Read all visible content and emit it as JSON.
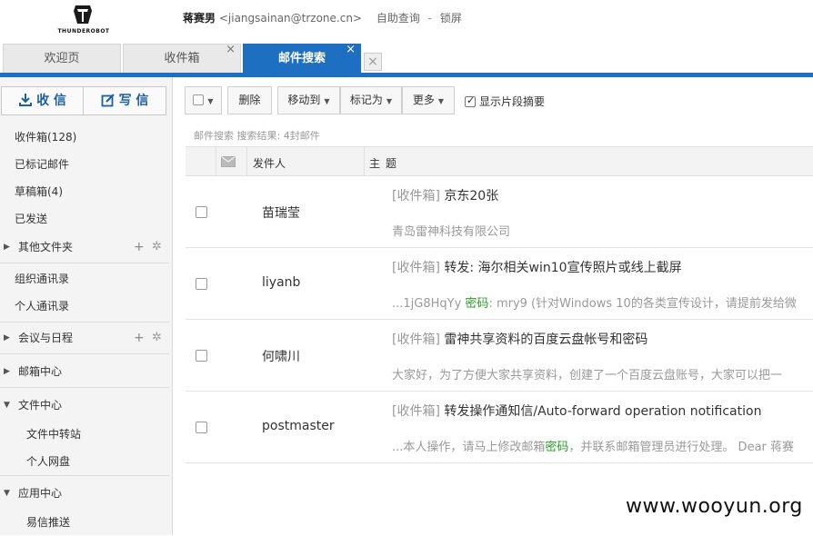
{
  "header": {
    "logo_text": "THUNDEROBOT",
    "user_name": "蒋赛男",
    "user_email": "<jiangsainan@trzone.cn>",
    "link_self_service": "自助查询",
    "separator": "-",
    "link_lock": "锁屏"
  },
  "tabs": [
    {
      "label": "欢迎页",
      "closable": false
    },
    {
      "label": "收件箱",
      "closable": true
    },
    {
      "label": "邮件搜索",
      "closable": true,
      "active": true
    }
  ],
  "tab_close_glyph": "×",
  "sidebar": {
    "receive_label": "收 信",
    "write_label": "写 信",
    "folders": [
      {
        "label": "收件箱(128)"
      },
      {
        "label": "已标记邮件"
      },
      {
        "label": "草稿箱(4)"
      },
      {
        "label": "已发送"
      }
    ],
    "other_folders": "其他文件夹",
    "contacts_org": "组织通讯录",
    "contacts_personal": "个人通讯录",
    "meetings": "会议与日程",
    "mailbox_center": "邮箱中心",
    "file_center": "文件中心",
    "file_transfer": "文件中转站",
    "personal_disk": "个人网盘",
    "app_center": "应用中心",
    "yixin_push": "易信推送"
  },
  "toolbar": {
    "delete": "删除",
    "move_to": "移动到",
    "mark_as": "标记为",
    "more": "更多",
    "show_summary": "显示片段摘要",
    "show_summary_checked": true
  },
  "search_info": "邮件搜索 搜索结果: 4封邮件",
  "table": {
    "col_sender": "发件人",
    "col_subject": "主题",
    "rows": [
      {
        "sender": "苗瑞莹",
        "folder": "[收件箱]",
        "subject": " 京东20张",
        "digest_pre": "青岛雷神科技有限公司",
        "digest_hl": "",
        "digest_post": ""
      },
      {
        "sender": "liyanb",
        "folder": "[收件箱]",
        "subject": " 转发: 海尔相关win10宣传照片或线上截屏",
        "digest_pre": "...1jG8HqYy ",
        "digest_hl": "密码",
        "digest_post": ": mry9 (针对Windows 10的各类宣传设计，请提前发给微"
      },
      {
        "sender": "何啸川",
        "folder": "[收件箱]",
        "subject": " 雷神共享资料的百度云盘帐号和密码",
        "digest_pre": "大家好，为了方便大家共享资料，创建了一个百度云盘账号，大家可以把一",
        "digest_hl": "",
        "digest_post": ""
      },
      {
        "sender": "postmaster",
        "folder": "[收件箱]",
        "subject": " 转发操作通知信/Auto-forward operation notification",
        "digest_pre": "...本人操作，请马上修改邮箱",
        "digest_hl": "密码",
        "digest_post": "，并联系邮箱管理员进行处理。 Dear 蒋赛"
      }
    ]
  },
  "watermark": "www.wooyun.org",
  "colors": {
    "accent": "#1d6fc1",
    "highlight_green": "#2a9a2a"
  }
}
